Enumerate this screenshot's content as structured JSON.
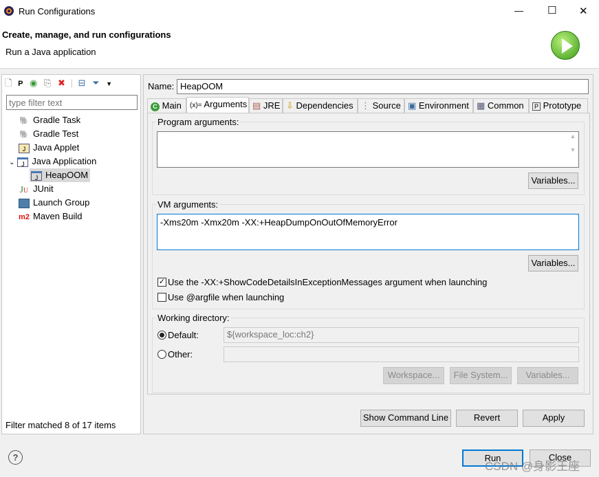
{
  "window": {
    "title": "Run Configurations",
    "minimize": "—",
    "maximize": "☐",
    "close": "✕"
  },
  "header": {
    "heading": "Create, manage, and run configurations",
    "subheading": "Run a Java application"
  },
  "sidebar": {
    "filter_placeholder": "type filter text",
    "items": [
      {
        "label": "Gradle Task",
        "icon": "gradle-elephant-icon"
      },
      {
        "label": "Gradle Test",
        "icon": "gradle-elephant-icon"
      },
      {
        "label": "Java Applet",
        "icon": "java-applet-icon"
      },
      {
        "label": "Java Application",
        "icon": "java-application-icon",
        "expanded": true,
        "children": [
          {
            "label": "HeapOOM",
            "selected": true
          }
        ]
      },
      {
        "label": "JUnit",
        "icon": "junit-icon"
      },
      {
        "label": "Launch Group",
        "icon": "launch-group-icon"
      },
      {
        "label": "Maven Build",
        "icon": "maven-icon"
      }
    ],
    "status": "Filter matched 8 of 17 items"
  },
  "config": {
    "name_label": "Name:",
    "name_value": "HeapOOM",
    "tabs": [
      {
        "label": "Main"
      },
      {
        "label": "Arguments",
        "active": true
      },
      {
        "label": "JRE"
      },
      {
        "label": "Dependencies"
      },
      {
        "label": "Source"
      },
      {
        "label": "Environment"
      },
      {
        "label": "Common"
      },
      {
        "label": "Prototype"
      }
    ],
    "program_args_label": "Program arguments:",
    "program_args_value": "",
    "variables_label": "Variables...",
    "vm_args_label": "VM arguments:",
    "vm_args_value": "-Xms20m -Xmx20m -XX:+HeapDumpOnOutOfMemoryError",
    "show_code_details": {
      "label": "Use the -XX:+ShowCodeDetailsInExceptionMessages argument when launching",
      "checked": true
    },
    "argfile": {
      "label": "Use @argfile when launching",
      "checked": false
    },
    "working_dir_label": "Working directory:",
    "default_label": "Default:",
    "default_value": "${workspace_loc:ch2}",
    "other_label": "Other:",
    "other_value": "",
    "workspace_btn": "Workspace...",
    "filesystem_btn": "File System...",
    "wd_variables_btn": "Variables..."
  },
  "footer": {
    "show_cmd": "Show Command Line",
    "revert": "Revert",
    "apply": "Apply",
    "run": "Run",
    "close": "Close",
    "help": "?"
  },
  "watermark": "CSDN @身影王座"
}
